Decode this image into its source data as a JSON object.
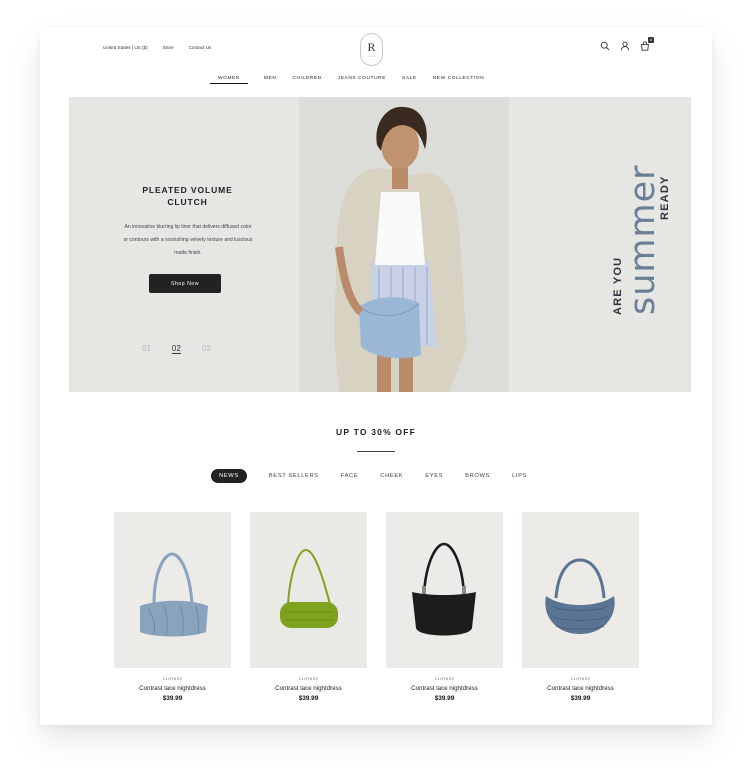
{
  "header": {
    "topbar_links": [
      "United States | US ($)",
      "Store",
      "Contact Us"
    ],
    "logo_letter": "R",
    "cart_count": "0",
    "icons": [
      "search-icon",
      "user-icon",
      "cart-icon"
    ]
  },
  "nav": {
    "items": [
      {
        "label": "WOMEN",
        "active": true
      },
      {
        "label": "MEN",
        "active": false
      },
      {
        "label": "CHILDREN",
        "active": false
      },
      {
        "label": "JEANS COUTURE",
        "active": false
      },
      {
        "label": "SALE",
        "active": false
      },
      {
        "label": "NEW COLLECTION",
        "active": false
      }
    ]
  },
  "hero": {
    "title": "PLEATED VOLUME CLUTCH",
    "description": "An innovative blurring lip liner that delivers diffused color or contours with a nourishing velvety texture and luscious matte finish.",
    "cta_label": "Shop Now",
    "pages": [
      {
        "label": "01",
        "active": false
      },
      {
        "label": "02",
        "active": true
      },
      {
        "label": "03",
        "active": false
      }
    ],
    "side_text": {
      "are_you": "ARE YOU",
      "summer": "summer",
      "ready": "READY"
    }
  },
  "promo": {
    "heading": "UP TO 30% OFF"
  },
  "tabs": [
    {
      "label": "NEWS",
      "active": true
    },
    {
      "label": "BEST SELLERS",
      "active": false
    },
    {
      "label": "FACE",
      "active": false
    },
    {
      "label": "CHEEK",
      "active": false
    },
    {
      "label": "EYES",
      "active": false
    },
    {
      "label": "BROWS",
      "active": false
    },
    {
      "label": "LIPS",
      "active": false
    }
  ],
  "products": [
    {
      "category": "CLOTHES",
      "name": "Contrast lace nightdress",
      "price": "$39.99",
      "bag_color": "#8aa3bd"
    },
    {
      "category": "CLOTHES",
      "name": "Contrast lace nightdress",
      "price": "$39.99",
      "bag_color": "#7fa21f"
    },
    {
      "category": "CLOTHES",
      "name": "Contrast lace nightdress",
      "price": "$39.99",
      "bag_color": "#1c1c1c"
    },
    {
      "category": "CLOTHES",
      "name": "Contrast lace nightdress",
      "price": "$39.99",
      "bag_color": "#5b7494"
    }
  ],
  "colors": {
    "accent_dark": "#222222",
    "summer_blue": "#6a7f97",
    "hero_bg": "#e6e6e3"
  }
}
